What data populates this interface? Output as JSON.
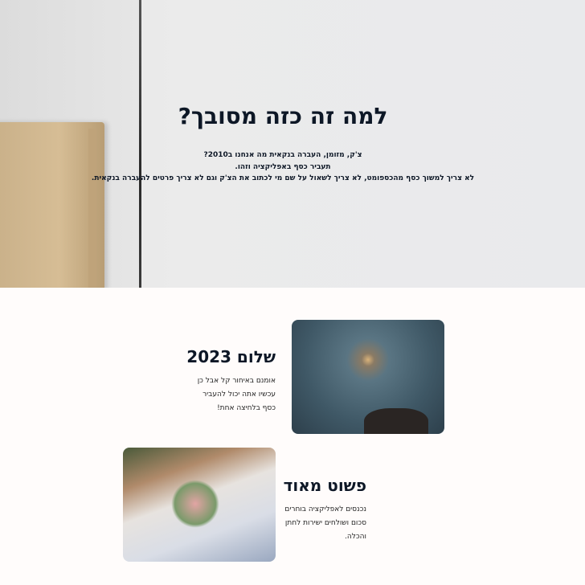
{
  "hero": {
    "title": "למה זה כזה מסובך?",
    "lines": [
      "צ'ק, מזומן, העברה בנקאית מה אנחנו ב2010?",
      "תעביר כסף באפליקציה וזהו.",
      "לא צריך למשוך כסף מהכספומט, לא צריך לשאול על שם מי לכתוב את הצ'ק וגם לא צריך פרטים להעברה בנקאית."
    ]
  },
  "features": [
    {
      "title": "שלום 2023",
      "lines": [
        "אומנם באיחור קל אבל כן",
        "עכשיו אתה יכול להעביר",
        "כסף בלחיצה אחת!"
      ]
    },
    {
      "title": "פשוט מאוד",
      "lines": [
        "נכנסים לאפליקציה בוחרים",
        "סכום ושולחים ישירות לחתן",
        "והכלה."
      ]
    }
  ]
}
